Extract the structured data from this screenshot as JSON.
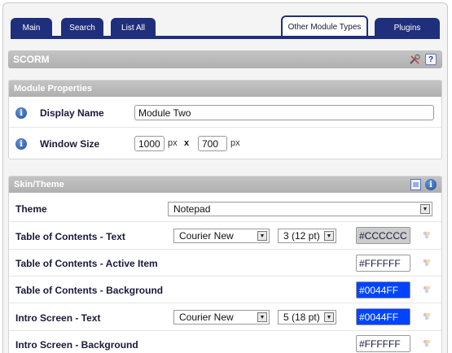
{
  "tabs": [
    {
      "label": "Main"
    },
    {
      "label": "Search"
    },
    {
      "label": "List All"
    },
    {
      "label": "Other Module Types"
    },
    {
      "label": "Plugins"
    }
  ],
  "scorm": {
    "title": "SCORM"
  },
  "module_properties": {
    "title": "Module Properties",
    "display_name_label": "Display Name",
    "display_name_value": "Module Two",
    "window_size_label": "Window Size",
    "width_value": "1000",
    "height_value": "700",
    "px_unit": "px",
    "x_sep": "x"
  },
  "skin": {
    "title": "Skin/Theme",
    "theme_label": "Theme",
    "theme_value": "Notepad",
    "rows": [
      {
        "label": "Table of Contents - Text",
        "font": "Courier New",
        "size": "3 (12 pt)",
        "color": "#CCCCCC",
        "bg": "#cccccc"
      },
      {
        "label": "Table of Contents - Active Item",
        "color": "#FFFFFF",
        "bg": "#ffffff"
      },
      {
        "label": "Table of Contents - Background",
        "color": "#0044FF",
        "bg": "#0044ff"
      },
      {
        "label": "Intro Screen - Text",
        "font": "Courier New",
        "size": "5 (18 pt)",
        "color": "#0044FF",
        "bg": "#0044ff"
      },
      {
        "label": "Intro Screen - Background",
        "color": "#FFFFFF",
        "bg": "#ffffff"
      }
    ]
  }
}
